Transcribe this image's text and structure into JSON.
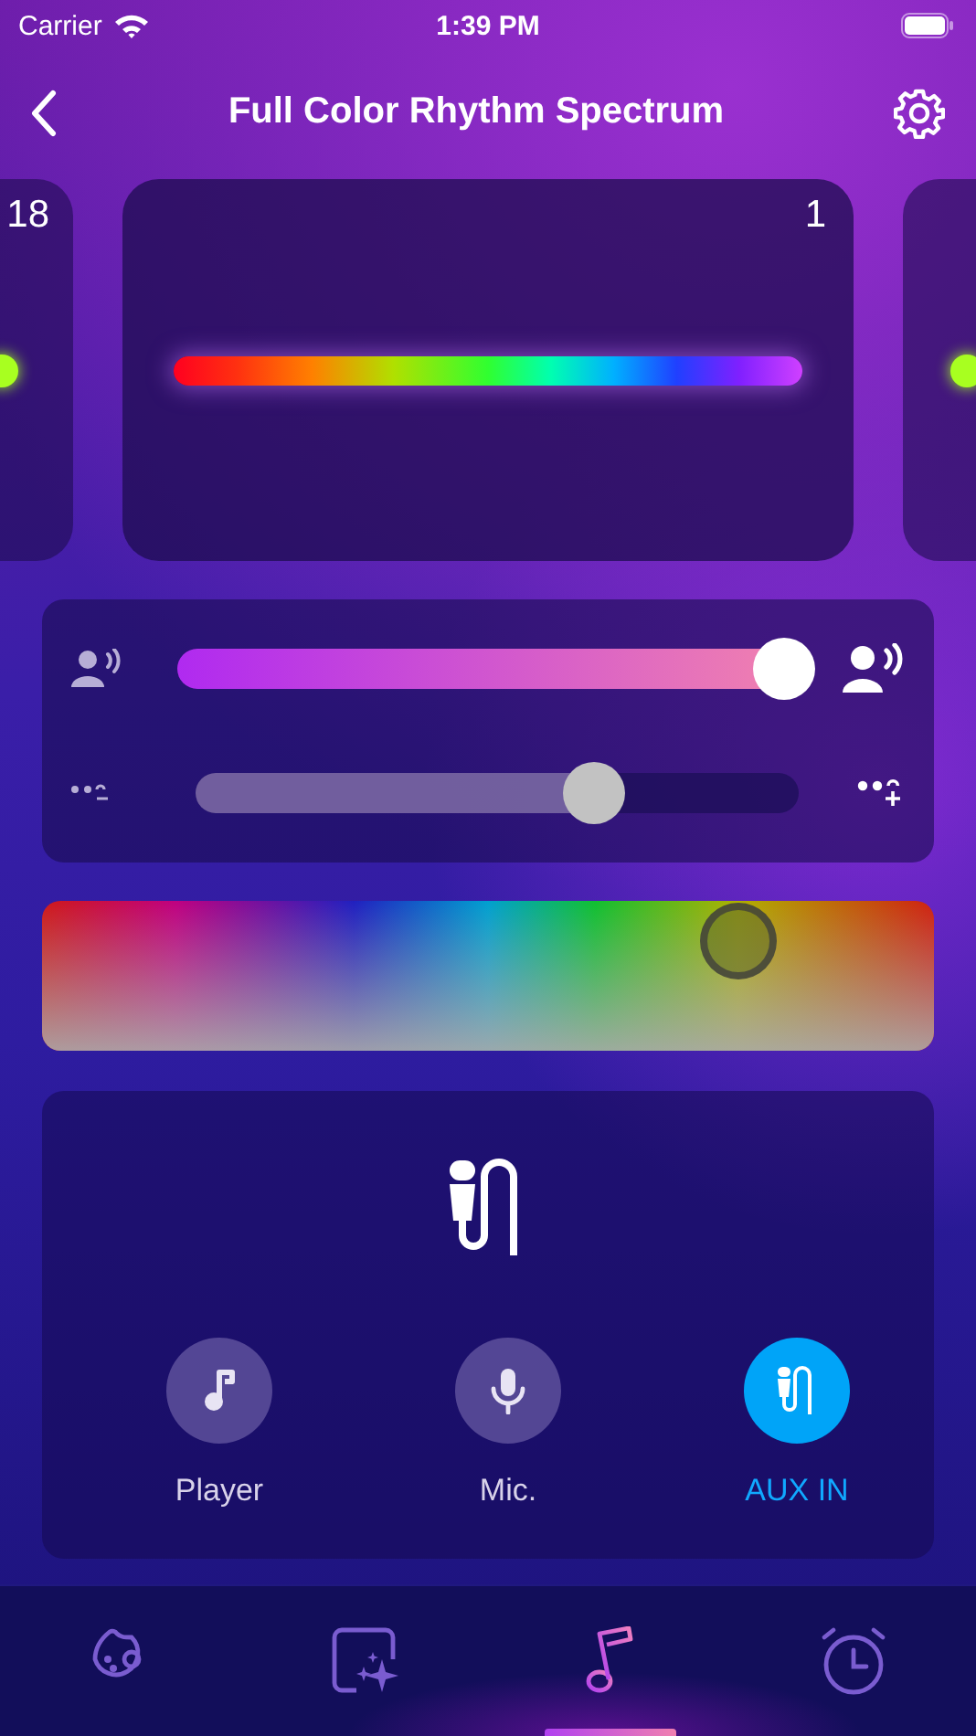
{
  "status_bar": {
    "carrier": "Carrier",
    "time": "1:39 PM"
  },
  "nav": {
    "title": "Full Color Rhythm Spectrum"
  },
  "cards": [
    {
      "label": "18",
      "selected": false
    },
    {
      "label": "1",
      "selected": true
    },
    {
      "selected": false
    }
  ],
  "sliders": [
    {
      "kind": "sensitivity",
      "level": 0.96
    },
    {
      "kind": "speed",
      "level": 0.66
    }
  ],
  "sources": [
    {
      "label": "Player",
      "kind": "player",
      "selected": false
    },
    {
      "label": "Mic.",
      "kind": "mic",
      "selected": false
    },
    {
      "label": "AUX IN",
      "kind": "aux",
      "selected": true
    }
  ],
  "tabs": [
    {
      "kind": "palette",
      "selected": false
    },
    {
      "kind": "scene",
      "selected": false
    },
    {
      "kind": "music",
      "selected": true
    },
    {
      "kind": "timer",
      "selected": false
    }
  ]
}
